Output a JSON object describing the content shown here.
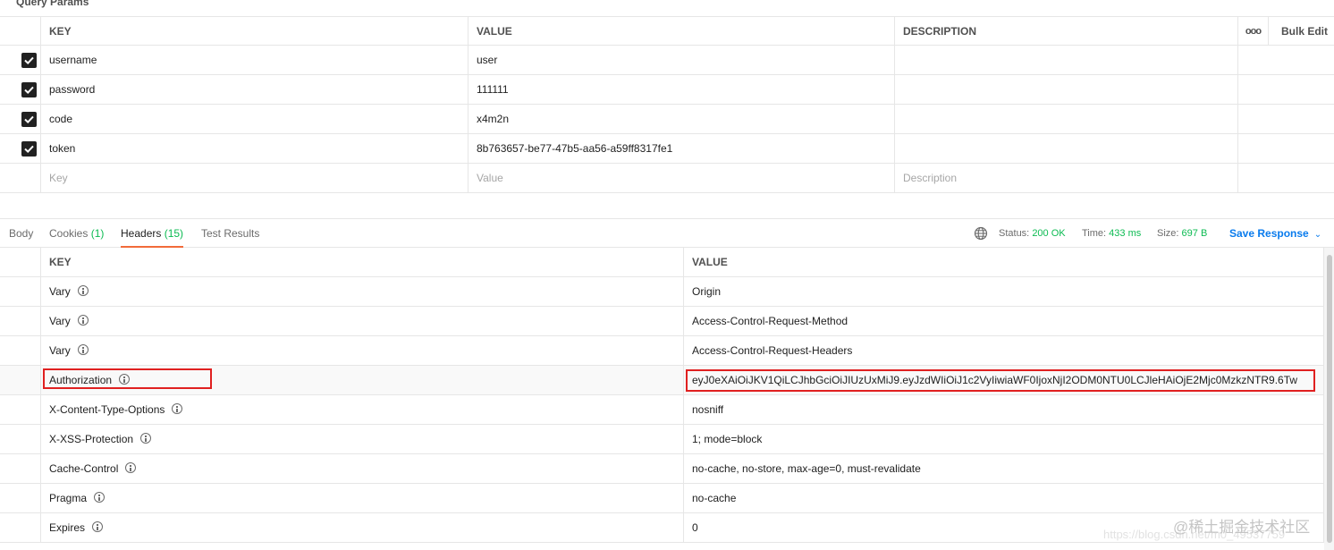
{
  "query_params": {
    "section_title": "Query Params",
    "headers": {
      "key": "KEY",
      "value": "VALUE",
      "description": "DESCRIPTION",
      "more": "ooo",
      "bulk_edit": "Bulk Edit"
    },
    "rows": [
      {
        "checked": true,
        "key": "username",
        "value": "user",
        "description": ""
      },
      {
        "checked": true,
        "key": "password",
        "value": "111111",
        "description": ""
      },
      {
        "checked": true,
        "key": "code",
        "value": "x4m2n",
        "description": ""
      },
      {
        "checked": true,
        "key": "token",
        "value": "8b763657-be77-47b5-aa56-a59ff8317fe1",
        "description": ""
      }
    ],
    "placeholders": {
      "key": "Key",
      "value": "Value",
      "description": "Description"
    }
  },
  "response": {
    "tabs": [
      {
        "label": "Body",
        "count": ""
      },
      {
        "label": "Cookies",
        "count": "(1)"
      },
      {
        "label": "Headers",
        "count": "(15)",
        "active": true
      },
      {
        "label": "Test Results",
        "count": ""
      }
    ],
    "status_label": "Status:",
    "status_value": "200 OK",
    "time_label": "Time:",
    "time_value": "433 ms",
    "size_label": "Size:",
    "size_value": "697 B",
    "save_response": "Save Response",
    "headers_table": {
      "key_header": "KEY",
      "value_header": "VALUE",
      "rows": [
        {
          "key": "Vary",
          "value": "Origin"
        },
        {
          "key": "Vary",
          "value": "Access-Control-Request-Method"
        },
        {
          "key": "Vary",
          "value": "Access-Control-Request-Headers"
        },
        {
          "key": "Authorization",
          "value": "eyJ0eXAiOiJKV1QiLCJhbGciOiJIUzUxMiJ9.eyJzdWIiOiJ1c2VyIiwiaWF0IjoxNjI2ODM0NTU0LCJleHAiOjE2Mjc0MzkzNTR9.6Tw"
        },
        {
          "key": "X-Content-Type-Options",
          "value": "nosniff"
        },
        {
          "key": "X-XSS-Protection",
          "value": "1; mode=block"
        },
        {
          "key": "Cache-Control",
          "value": "no-cache, no-store, max-age=0, must-revalidate"
        },
        {
          "key": "Pragma",
          "value": "no-cache"
        },
        {
          "key": "Expires",
          "value": "0"
        }
      ]
    }
  },
  "watermark": {
    "text": "@稀土掘金技术社区",
    "sub": "https://blog.csdn.net/m0_49537759"
  },
  "colors": {
    "accent_tab": "#f26b3a",
    "status_green": "#0cbb52",
    "link_blue": "#097bed",
    "highlight_red": "#e02020"
  }
}
